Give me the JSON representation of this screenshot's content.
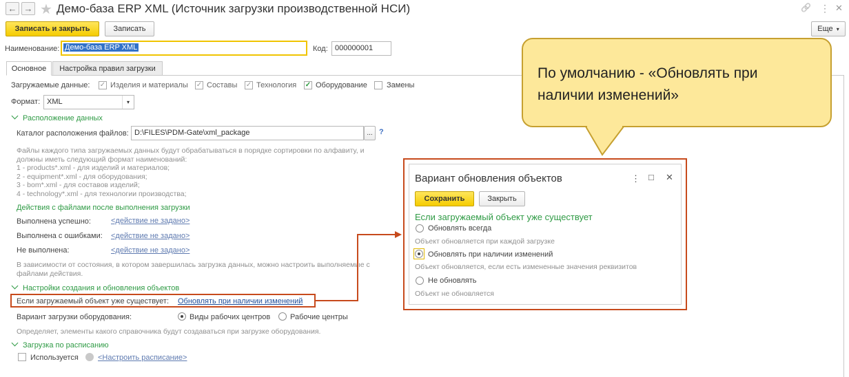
{
  "window": {
    "title": "Демо-база ERP XML (Источник загрузки производственной НСИ)",
    "back_glyph": "←",
    "forward_glyph": "→",
    "star_glyph": "★",
    "link_glyph": "🔗",
    "menu_glyph": "⋮",
    "close_glyph": "✕"
  },
  "toolbar": {
    "save_close_label": "Записать и закрыть",
    "save_label": "Записать",
    "more_label": "Еще"
  },
  "form": {
    "name_label": "Наименование:",
    "name_value": "Демо-база ERP XML",
    "code_label": "Код:",
    "code_value": "000000001",
    "tabs": [
      "Основное",
      "Настройка правил загрузки"
    ],
    "loaded_data_label": "Загружаемые данные:",
    "checkboxes": [
      {
        "label": "Изделия и материалы",
        "checked": true
      },
      {
        "label": "Составы",
        "checked": true
      },
      {
        "label": "Технология",
        "checked": true
      },
      {
        "label": "Оборудование",
        "checked": true
      },
      {
        "label": "Замены",
        "checked": false
      }
    ],
    "format_label": "Формат:",
    "format_value": "XML",
    "files_section": "Расположение данных",
    "catalog_label": "Каталог расположения файлов:",
    "catalog_value": "D:\\FILES\\PDM-Gate\\xml_package",
    "catalog_btn": "...",
    "help_glyph": "?",
    "files_desc": [
      "Файлы каждого типа загружаемых данных будут обрабатываться в порядке сортировки по алфавиту, и",
      "должны иметь следующий формат наименований:",
      "1 - products*.xml - для изделий и материалов;",
      "2 - equipment*.xml - для оборудования;",
      "3 - bom*.xml - для составов изделий;",
      "4 - technology*.xml - для технологии производства;"
    ],
    "actions_head": "Действия с файлами после выполнения загрузки",
    "actions": [
      {
        "label": "Выполнена успешно:",
        "value": "<действие не задано>"
      },
      {
        "label": "Выполнена с ошибками:",
        "value": "<действие не задано>"
      },
      {
        "label": "Не выполнена:",
        "value": "<действие не задано>"
      }
    ],
    "actions_desc": [
      "В зависимости от состояния, в котором завершилась загрузка данных, можно настроить выполняемые с",
      "файлами действия."
    ],
    "objects_section": "Настройки создания и обновления объектов",
    "exists_label": "Если загружаемый объект уже существует:",
    "exists_value": "Обновлять при наличии изменений",
    "equip_label": "Вариант загрузки оборудования:",
    "equip_opt1": "Виды рабочих центров",
    "equip_opt2": "Рабочие центры",
    "equip_desc": "Определяет, элементы какого справочника будут создаваться при загрузке оборудования.",
    "schedule_section": "Загрузка по расписанию",
    "schedule_used": "Используется",
    "schedule_link": "<Настроить расписание>"
  },
  "popup": {
    "title": "Вариант обновления объектов",
    "save_label": "Сохранить",
    "close_label": "Закрыть",
    "maximize_glyph": "□",
    "heading": "Если загружаемый объект уже существует",
    "options": [
      {
        "label": "Обновлять всегда",
        "desc": "Объект обновляется при каждой загрузке",
        "selected": false
      },
      {
        "label": "Обновлять при наличии изменений",
        "desc": "Объект обновляется, если есть измененные значения реквизитов",
        "selected": true
      },
      {
        "label": "Не обновлять",
        "desc": "Объект не обновляется",
        "selected": false
      }
    ]
  },
  "callout": {
    "line1": "По умолчанию - «Обновлять при",
    "line2": "наличии изменений»"
  },
  "colors": {
    "accent_yellow": "#f5cc00",
    "highlight_red": "#c74a1c",
    "section_green": "#2e9a44",
    "callout_fill": "#fde89a"
  }
}
